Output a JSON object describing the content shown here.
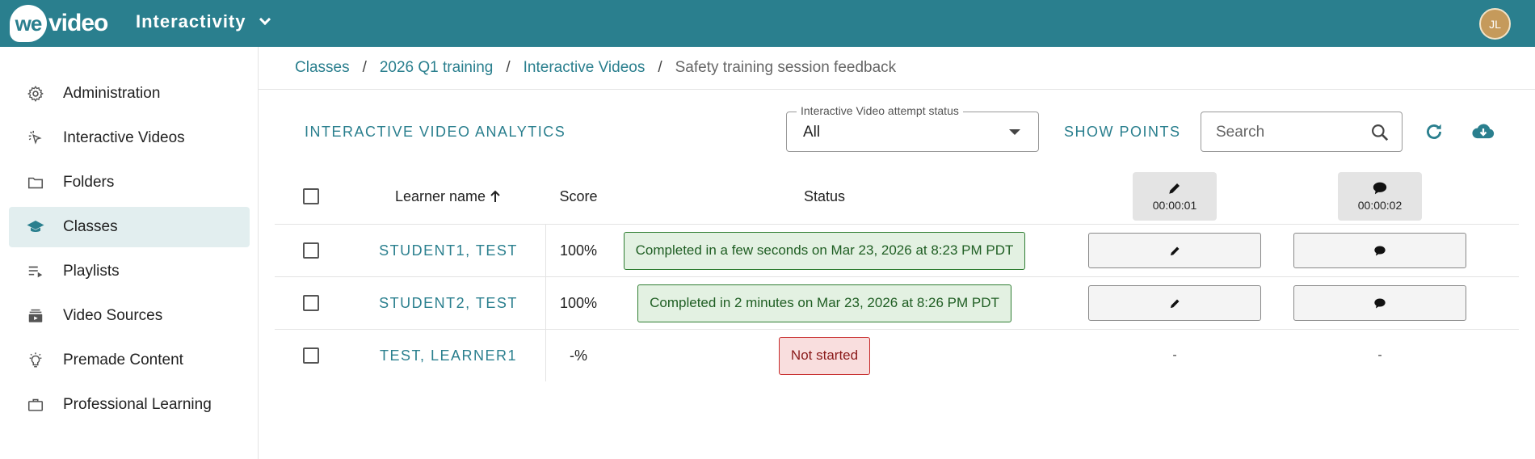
{
  "topbar": {
    "logo_we": "we",
    "logo_video": "video",
    "app_name": "Interactivity",
    "avatar_initials": "JL"
  },
  "sidebar": {
    "items": [
      {
        "label": "Administration",
        "icon": "gear-icon"
      },
      {
        "label": "Interactive Videos",
        "icon": "cursor-click-icon"
      },
      {
        "label": "Folders",
        "icon": "folder-icon"
      },
      {
        "label": "Classes",
        "icon": "graduation-cap-icon",
        "active": true
      },
      {
        "label": "Playlists",
        "icon": "playlist-icon"
      },
      {
        "label": "Video Sources",
        "icon": "video-library-icon"
      },
      {
        "label": "Premade Content",
        "icon": "lightbulb-icon"
      },
      {
        "label": "Professional Learning",
        "icon": "briefcase-icon"
      }
    ]
  },
  "breadcrumb": {
    "items": [
      "Classes",
      "2026 Q1 training",
      "Interactive Videos"
    ],
    "current": "Safety training session feedback",
    "separator": "/"
  },
  "toolbar": {
    "section_title": "INTERACTIVE VIDEO ANALYTICS",
    "status_filter_label": "Interactive Video attempt status",
    "status_filter_value": "All",
    "show_points_label": "SHOW POINTS",
    "search_placeholder": "Search"
  },
  "table": {
    "columns": {
      "learner": "Learner name",
      "score": "Score",
      "status": "Status"
    },
    "interaction_columns": [
      {
        "icon": "pencil-icon",
        "time": "00:00:01"
      },
      {
        "icon": "comment-icon",
        "time": "00:00:02"
      }
    ],
    "rows": [
      {
        "name": "STUDENT1, TEST",
        "score": "100%",
        "status": "Completed in a few seconds on Mar 23, 2026 at 8:23 PM PDT",
        "status_type": "completed",
        "int1": "",
        "int2": ""
      },
      {
        "name": "STUDENT2, TEST",
        "score": "100%",
        "status": "Completed in 2 minutes on Mar 23, 2026 at 8:26 PM PDT",
        "status_type": "completed",
        "int1": "",
        "int2": ""
      },
      {
        "name": "TEST, LEARNER1",
        "score": "-%",
        "status": "Not started",
        "status_type": "not-started",
        "int1": "-",
        "int2": "-"
      }
    ]
  },
  "colors": {
    "brand": "#2a7f8e",
    "completed_bg": "#e3f1e2",
    "not_started_bg": "#f9dede"
  }
}
